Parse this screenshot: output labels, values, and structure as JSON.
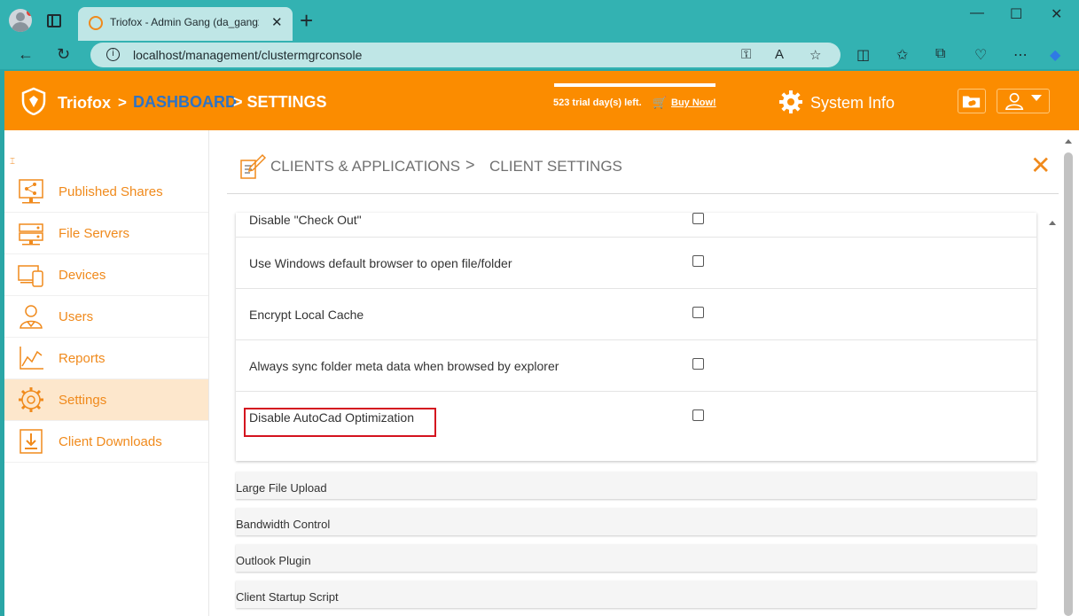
{
  "browser": {
    "tab_title": "Triofox - Admin Gang (da_gangx",
    "tab_close": "✕",
    "new_tab": "+",
    "minimize": "—",
    "maximize": "☐",
    "close": "✕",
    "url": "localhost/management/clustermgrconsole",
    "back": "←",
    "reload": "↻",
    "info_glyph": "i",
    "key_glyph": "⚿",
    "read_glyph": "A",
    "star_glyph": "☆",
    "split_glyph": "◫",
    "favorites_glyph": "✩",
    "collections_glyph": "⧉",
    "health_glyph": "♡",
    "more_glyph": "⋯",
    "copilot_glyph": "◆"
  },
  "header": {
    "brand": "Triofox",
    "sep": ">",
    "dashboard": "DASHBOARD",
    "settings": "> SETTINGS",
    "trial": "523 trial day(s) left.",
    "cart_glyph": "🛒",
    "buy_now": "Buy Now!",
    "system_info": "System Info"
  },
  "sidebar": {
    "collapse_glyph": "⌶",
    "items": [
      {
        "label": "Published Shares"
      },
      {
        "label": "File Servers"
      },
      {
        "label": "Devices"
      },
      {
        "label": "Users"
      },
      {
        "label": "Reports"
      },
      {
        "label": "Settings"
      },
      {
        "label": "Client Downloads"
      }
    ]
  },
  "content": {
    "crumb1": "CLIENTS & APPLICATIONS",
    "crumb_sep": ">",
    "crumb2": "CLIENT SETTINGS",
    "close_glyph": "✕",
    "options": [
      {
        "label": "Disable \"Check Out\"",
        "checked": false
      },
      {
        "label": "Use Windows default browser to open file/folder",
        "checked": false
      },
      {
        "label": "Encrypt Local Cache",
        "checked": false
      },
      {
        "label": "Always sync folder meta data when browsed by explorer",
        "checked": false
      },
      {
        "label": "Disable AutoCad Optimization",
        "checked": false
      }
    ],
    "sections": [
      {
        "label": "Large File Upload"
      },
      {
        "label": "Bandwidth Control"
      },
      {
        "label": "Outlook Plugin"
      },
      {
        "label": "Client Startup Script"
      }
    ]
  },
  "colors": {
    "accent": "#fb8c00",
    "nav_text": "#f08a1c",
    "active_bg": "#fde7cc",
    "link_blue": "#2e73c4",
    "highlight_red": "#d4131f"
  }
}
